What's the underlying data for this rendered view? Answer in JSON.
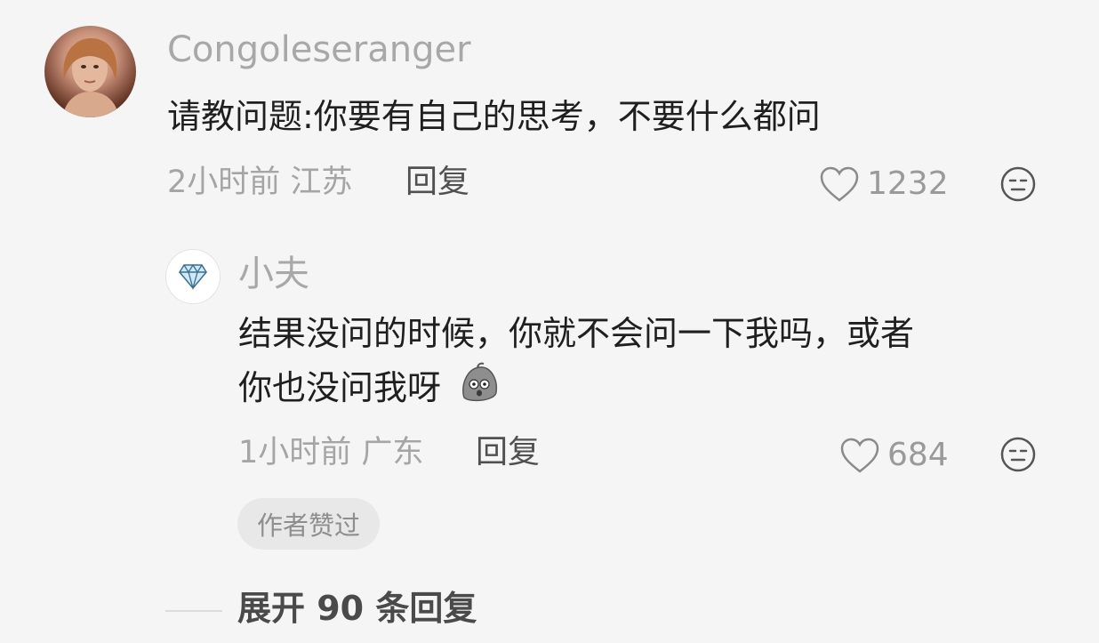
{
  "main_comment": {
    "username": "Congoleseranger",
    "text": "请教问题:你要有自己的思考，不要什么都问",
    "time": "2小时前",
    "location": "江苏",
    "reply_label": "回复",
    "like_count": "1232"
  },
  "reply_comment": {
    "username": "小夫",
    "text_line1": "结果没问的时候，你就不会问一下我吗，或者",
    "text_line2": "你也没问我呀",
    "time": "1小时前",
    "location": "广东",
    "reply_label": "回复",
    "like_count": "684",
    "badge": "作者赞过"
  },
  "expand_replies": "展开 90 条回复",
  "colors": {
    "background": "#f5f5f5",
    "username": "#a8a8a8",
    "text": "#1f1f1f",
    "meta": "#a5a5a5"
  }
}
